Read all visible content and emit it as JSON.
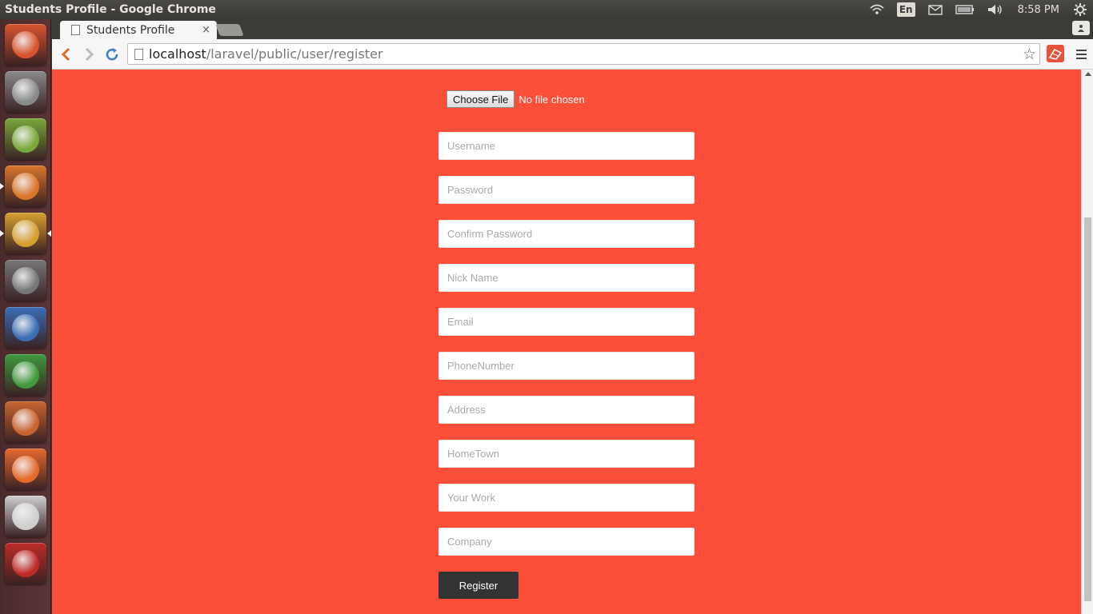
{
  "window": {
    "title": "Students Profile - Google Chrome"
  },
  "panel": {
    "keyboard": "En",
    "clock": "8:58 PM"
  },
  "launcher": {
    "items": [
      {
        "name": "ubuntu-dash-icon",
        "color": "#d8542f"
      },
      {
        "name": "files-icon",
        "color": "#8a8a8a"
      },
      {
        "name": "android-icon",
        "color": "#79a83b"
      },
      {
        "name": "firefox-icon",
        "color": "#d9762a"
      },
      {
        "name": "chrome-icon",
        "color": "#d6a030"
      },
      {
        "name": "system-settings-icon",
        "color": "#777777"
      },
      {
        "name": "libreoffice-writer-icon",
        "color": "#3a6eb5"
      },
      {
        "name": "libreoffice-calc-icon",
        "color": "#3f9a3f"
      },
      {
        "name": "libreoffice-impress-icon",
        "color": "#c8642e"
      },
      {
        "name": "software-center-icon",
        "color": "#e66a2c"
      },
      {
        "name": "amazon-icon",
        "color": "#cfcfcf"
      },
      {
        "name": "filezilla-icon",
        "color": "#bf2b28"
      }
    ]
  },
  "tab": {
    "label": "Students Profile",
    "close": "×"
  },
  "address_bar": {
    "host": "localhost",
    "path": "/laravel/public/user/register"
  },
  "colors": {
    "page_bg": "#fc4f39",
    "button_bg": "#333333"
  },
  "form": {
    "choose_file_label": "Choose File",
    "file_status": "No file chosen",
    "fields": [
      {
        "placeholder": "Username"
      },
      {
        "placeholder": "Password"
      },
      {
        "placeholder": "Confirm Password"
      },
      {
        "placeholder": "Nick Name"
      },
      {
        "placeholder": "Email"
      },
      {
        "placeholder": "PhoneNumber"
      },
      {
        "placeholder": "Address"
      },
      {
        "placeholder": "HomeTown"
      },
      {
        "placeholder": "Your Work"
      },
      {
        "placeholder": "Company"
      }
    ],
    "register_label": "Register"
  }
}
